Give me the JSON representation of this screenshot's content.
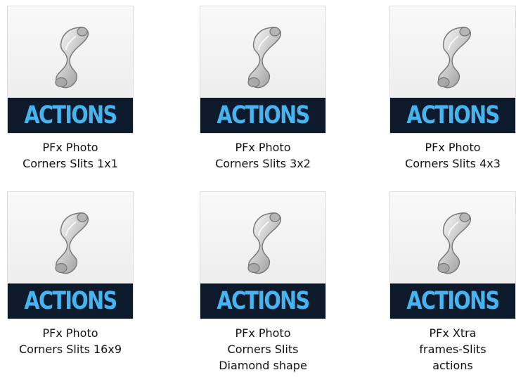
{
  "files": [
    {
      "banner": "ACTIONS",
      "name": "PFx Photo\nCorners Slits 1x1",
      "icon": "scroll-icon"
    },
    {
      "banner": "ACTIONS",
      "name": "PFx Photo\nCorners Slits 3x2",
      "icon": "scroll-icon"
    },
    {
      "banner": "ACTIONS",
      "name": "PFx Photo\nCorners Slits 4x3",
      "icon": "scroll-icon"
    },
    {
      "banner": "ACTIONS",
      "name": "PFx Photo\nCorners Slits 16x9",
      "icon": "scroll-icon"
    },
    {
      "banner": "ACTIONS",
      "name": "PFx Photo\nCorners Slits\nDiamond shape",
      "icon": "scroll-icon"
    },
    {
      "banner": "ACTIONS",
      "name": "PFx Xtra\nframes-Slits\nactions",
      "icon": "scroll-icon"
    }
  ],
  "colors": {
    "banner_bg": "#0c1a2c",
    "banner_text": "#46b4f0",
    "icon_bg": "#f2f2f2"
  }
}
